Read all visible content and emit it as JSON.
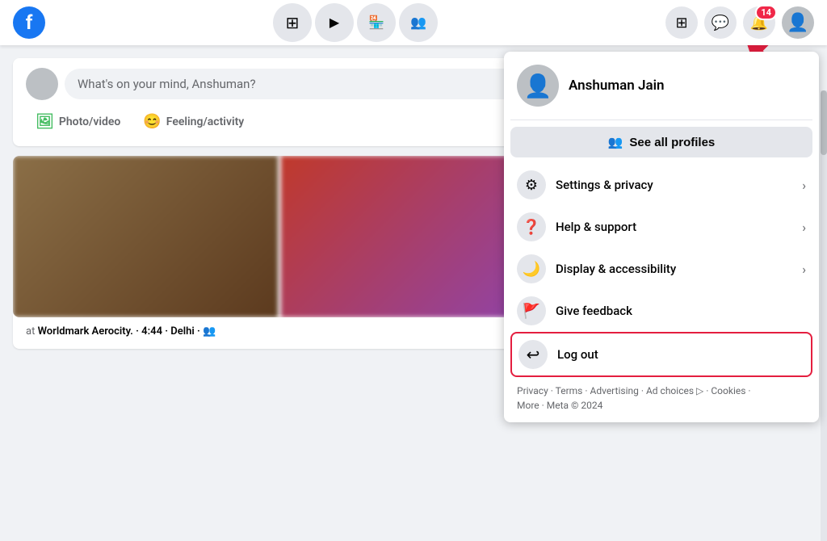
{
  "header": {
    "logo_text": "f",
    "nav_icons": [
      "⊞",
      "▶",
      "🏪",
      "👥"
    ],
    "right_icons": {
      "grid_label": "grid-icon",
      "messenger_label": "messenger-icon",
      "notifications_label": "notifications-icon",
      "notification_badge": "14",
      "profile_label": "profile-icon"
    }
  },
  "post_composer": {
    "placeholder": "What's on your mind, Anshuman?",
    "photo_video_label": "Photo/video",
    "feeling_label": "Feeling/activity"
  },
  "post": {
    "location": "Worldmark Aerocity.",
    "time": "4:44",
    "city": "Delhi",
    "privacy_icon": "👥"
  },
  "dropdown": {
    "profile_name": "Anshuman Jain",
    "see_all_profiles_label": "See all profiles",
    "see_all_icon": "👥",
    "menu_items": [
      {
        "id": "settings",
        "icon": "⚙",
        "label": "Settings & privacy",
        "has_chevron": true
      },
      {
        "id": "help",
        "icon": "❓",
        "label": "Help & support",
        "has_chevron": true
      },
      {
        "id": "display",
        "icon": "🌙",
        "label": "Display & accessibility",
        "has_chevron": true
      },
      {
        "id": "feedback",
        "icon": "🚩",
        "label": "Give feedback",
        "has_chevron": false
      },
      {
        "id": "logout",
        "icon": "↩",
        "label": "Log out",
        "has_chevron": false
      }
    ],
    "footer": {
      "links": [
        "Privacy",
        "Terms",
        "Advertising",
        "Ad choices",
        "Cookies",
        "More"
      ],
      "separator": " · ",
      "meta": "Meta © 2024"
    }
  },
  "arrow": {
    "color": "#e41e3f"
  }
}
